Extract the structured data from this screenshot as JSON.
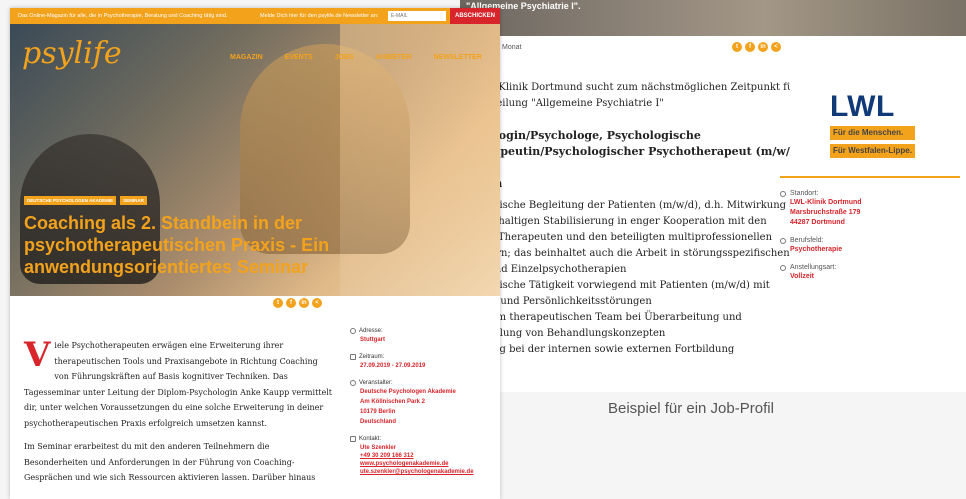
{
  "job": {
    "hero_caption": "\"Allgemeine Psychiatrie I\".",
    "meta": "Monat",
    "share_icons": [
      "twitter-icon",
      "facebook-icon",
      "linkedin-icon",
      "share-icon"
    ],
    "share_glyphs": [
      "t",
      "f",
      "in",
      "<"
    ],
    "text_lines": [
      "ie LWL-Klinik Dortmund sucht zum nächstmöglichen Zeitpunkt für",
      "die Abteilung \"Allgemeine Psychiatrie I\"",
      "",
      "sychologin/Psychologe, Psychologische",
      "otherapeutin/Psychologischer Psychotherapeut (m/w/d)",
      "",
      "",
      "fgaben",
      "",
      "erapeutische Begleitung der Patienten (m/w/d), d.h. Mitwirkung an",
      "er nachhaltigen Stabilisierung in enger Kooperation mit den",
      "tlichen Therapeuten und den beteiligten multiprofessionellen",
      "arbeitern; das beinhaltet auch die Arbeit in störungsspezifischen",
      "ppen und Einzelpsychotherapien",
      "erapeutische Tätigkeit vorwiegend mit Patienten (m/w/d) mit",
      "ektiven und Persönlichkeitsstörungen",
      "arbeit im therapeutischen Team bei Überarbeitung und",
      "entwicklung von Behandlungskonzepten",
      "twirkung bei der internen sowie externen Fortbildung"
    ],
    "logo": "LWL",
    "logo_tagline": [
      "Für die Menschen.",
      "Für Westfalen-Lippe."
    ],
    "details": [
      {
        "label": "Standort:",
        "values": [
          "LWL-Klinik Dortmund",
          "Marsbruchstraße 179",
          "44287 Dortmund"
        ]
      },
      {
        "label": "Berufsfeld:",
        "values": [
          "Psychotherapie"
        ]
      },
      {
        "label": "Anstellungsart:",
        "values": [
          "Vollzeit"
        ]
      }
    ]
  },
  "caption": "Beispiel für ein Job-Profil",
  "seminar": {
    "topbar_intro": "Das Online-Magazin für alle, die in Psychotherapie, Beratung und Coaching tätig sind.",
    "topbar_newsletter": "Melde Dich hier für den psylife.de Newsletter an:",
    "email_placeholder": "E-MAIL",
    "subscribe": "ABSCHICKEN",
    "brand": "psylife",
    "nav": [
      "MAGAZIN",
      "EVENTS",
      "JOBS",
      "ANBIETER",
      "NEWSLETTER"
    ],
    "tags": [
      "DEUTSCHE PSYCHOLOGEN AKADEMIE",
      "SEMINAR"
    ],
    "headline": "Coaching als 2. Standbein in der psychotherapeutischen Praxis - Ein anwendungsorientiertes Seminar",
    "dropcap": "V",
    "para1": "iele Psychotherapeuten erwägen eine Erweiterung ihrer therapeutischen Tools und Praxisangebote in Richtung Coaching von Führungskräften auf Basis kognitiver Techniken. Das Tagesseminar unter Leitung der Diplom-Psychologin Anke Kaupp vermittelt dir, unter welchen Voraussetzungen du eine solche Erweiterung in deiner psychotherapeutischen Praxis erfolgreich umsetzen kannst.",
    "para2": "Im Seminar erarbeitest du mit den anderen Teilnehmern die Besonderheiten und Anforderungen in der Führung von Coaching-Gesprächen und wie sich Ressourcen aktivieren lassen. Darüber hinaus",
    "details": {
      "address_label": "Adresse:",
      "address_value": "Stuttgart",
      "period_label": "Zeitraum:",
      "period_value": "27.09.2019 - 27.09.2019",
      "organizer_label": "Veranstalter:",
      "organizer_lines": [
        "Deutsche Psychologen Akademie",
        "Am Köllnischen Park 2",
        "10179 Berlin",
        "Deutschland"
      ],
      "contact_label": "Kontakt:",
      "contact_name": "Ute Szenkler",
      "contact_phone": "+49 30 209 166 312",
      "contact_web": "www.psychologenakademie.de",
      "contact_mail": "ute.szenkler@psychologenakademie.de"
    }
  },
  "colors": {
    "accent": "#f3a21c",
    "link": "#d8252b",
    "lwl_blue": "#0f3977"
  }
}
